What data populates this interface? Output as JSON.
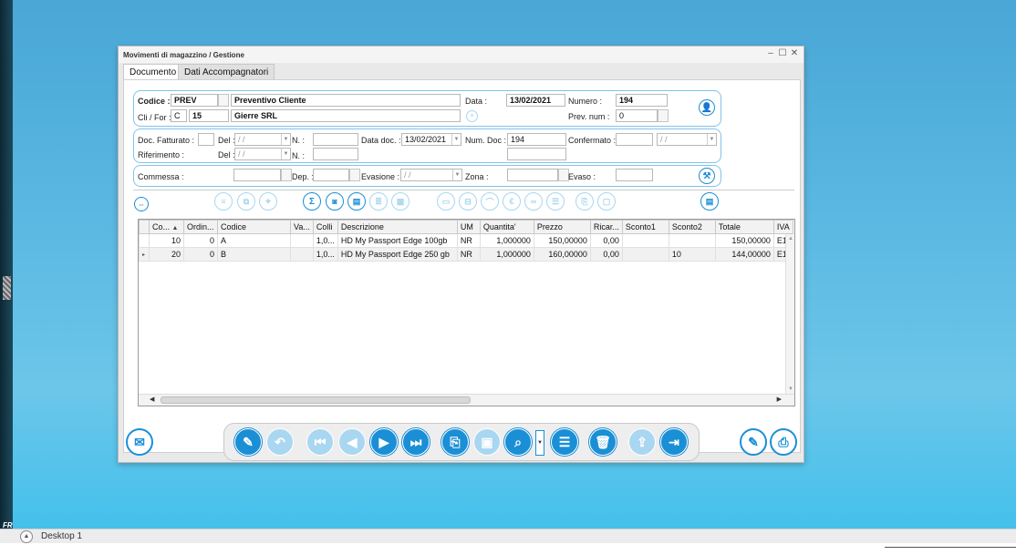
{
  "window": {
    "title": "Movimenti di magazzino / Gestione",
    "tabs": [
      "Documento",
      "Dati Accompagnatori"
    ]
  },
  "header": {
    "codice_label": "Codice :",
    "codice_value": "PREV",
    "codice_desc": "Preventivo Cliente",
    "data_label": "Data :",
    "data_value": "13/02/2021",
    "numero_label": "Numero :",
    "numero_value": "194",
    "clifor_label": "Cli / For :",
    "clifor_type": "C",
    "clifor_code": "15",
    "clifor_name": "Gierre SRL",
    "prevnum_label": "Prev. num :",
    "prevnum_value": "0"
  },
  "docinfo": {
    "doc_fatturato_label": "Doc. Fatturato :",
    "del_label": "Del :",
    "del_value": "/ /",
    "n_label": "N. :",
    "data_doc_label": "Data doc. :",
    "data_doc_value": "13/02/2021",
    "num_doc_label": "Num. Doc :",
    "num_doc_value": "194",
    "confermato_label": "Confermato :",
    "confermato_date": "/ /",
    "riferimento_label": "Riferimento :",
    "del2_label": "Del :",
    "del2_value": "/ /",
    "n2_label": "N. :"
  },
  "commessa": {
    "commessa_label": "Commessa :",
    "dep_label": "Dep. :",
    "evasione_label": "Evasione :",
    "evasione_value": "/ /",
    "zona_label": "Zona :",
    "evaso_label": "Evaso :"
  },
  "table": {
    "headers": [
      "Co...",
      "Ordin...",
      "Codice",
      "Va...",
      "Colli",
      "Descrizione",
      "UM",
      "Quantita'",
      "Prezzo",
      "Ricar...",
      "Sconto1",
      "Sconto2",
      "Totale",
      "IVA"
    ],
    "sort_indicator": "▲",
    "rows": [
      {
        "co": "10",
        "ordin": "0",
        "codice": "A",
        "va": "",
        "colli": "1,0...",
        "descrizione": "HD My Passport Edge 100gb",
        "um": "NR",
        "quantita": "1,000000",
        "prezzo": "150,00000",
        "ricar": "0,00",
        "sconto1": "",
        "sconto2": "",
        "totale": "150,00000",
        "iva": "E1"
      },
      {
        "co": "20",
        "ordin": "0",
        "codice": "B",
        "va": "",
        "colli": "1,0...",
        "descrizione": "HD My Passport Edge 250 gb",
        "um": "NR",
        "quantita": "1,000000",
        "prezzo": "160,00000",
        "ricar": "0,00",
        "sconto1": "",
        "sconto2": "10",
        "totale": "144,00000",
        "iva": "E1"
      }
    ]
  },
  "taskbar": {
    "desktop_label": "Desktop 1",
    "side_label": "FR"
  }
}
